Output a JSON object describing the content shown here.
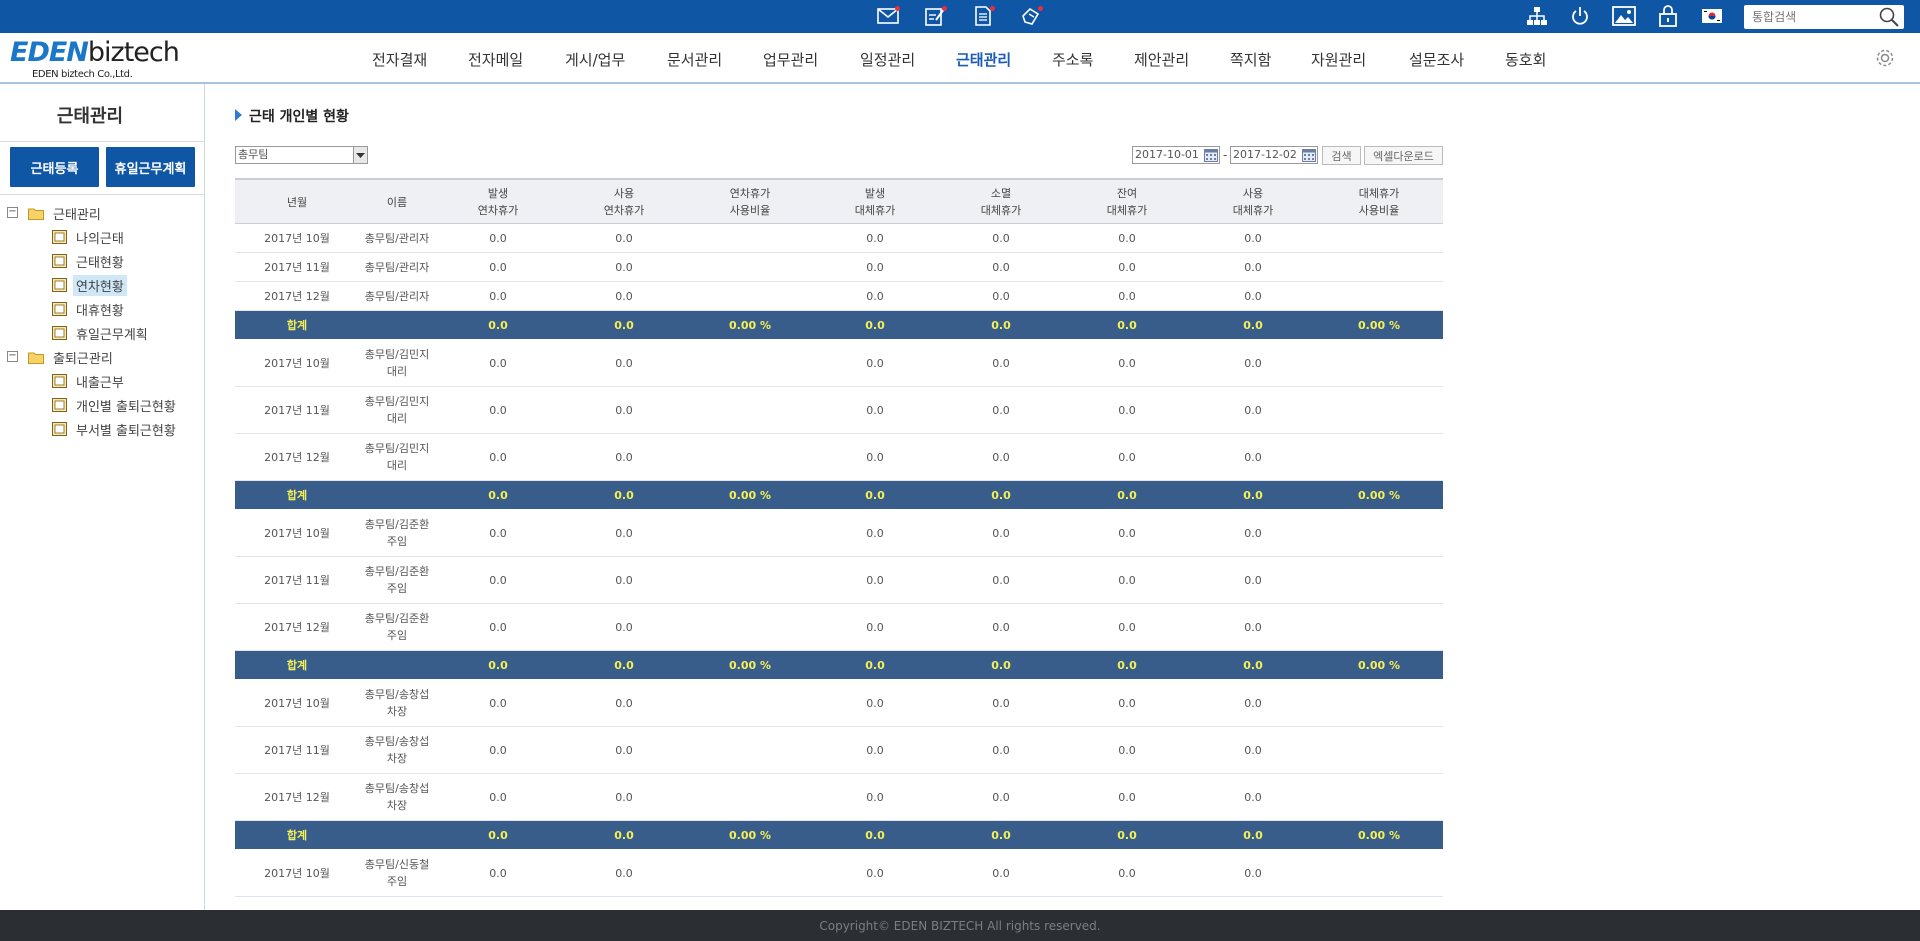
{
  "topbar": {
    "icons": [
      "mail-icon",
      "approval-icon",
      "document-icon",
      "hand-icon"
    ],
    "right_icons": [
      "org-chart-icon",
      "power-icon",
      "picture-icon",
      "lock-icon",
      "korea-flag-icon"
    ],
    "search_placeholder": "통합검색",
    "color": "#0f57a5"
  },
  "logo": {
    "main_eden": "EDEN",
    "main_biz": "biztech",
    "sub": "EDEN biztech Co.,Ltd."
  },
  "nav": {
    "items": [
      "전자결재",
      "전자메일",
      "게시/업무",
      "문서관리",
      "업무관리",
      "일정관리",
      "근태관리",
      "주소록",
      "제안관리",
      "쪽지함",
      "자원관리",
      "설문조사",
      "동호회"
    ],
    "active": "근태관리"
  },
  "sidebar": {
    "title": "근태관리",
    "btn_register": "근태등록",
    "btn_holiday": "휴일근무계획",
    "tree": [
      {
        "label": "근태관리",
        "type": "folder",
        "toggle": "−"
      },
      {
        "label": "나의근태",
        "type": "page"
      },
      {
        "label": "근태현황",
        "type": "page"
      },
      {
        "label": "연차현황",
        "type": "page",
        "selected": true
      },
      {
        "label": "대휴현황",
        "type": "page"
      },
      {
        "label": "휴일근무계획",
        "type": "page"
      },
      {
        "label": "출퇴근관리",
        "type": "folder",
        "toggle": "−"
      },
      {
        "label": "내출근부",
        "type": "page"
      },
      {
        "label": "개인별 출퇴근현황",
        "type": "page"
      },
      {
        "label": "부서별 출퇴근현황",
        "type": "page"
      }
    ]
  },
  "content": {
    "title": "근태 개인별 현황",
    "dept_value": "총무팀",
    "date_from": "2017-10-01",
    "date_sep": "-",
    "date_to": "2017-12-02",
    "search_btn": "검색",
    "excel_btn": "엑셀다운로드"
  },
  "table": {
    "headers": [
      [
        "년월"
      ],
      [
        "이름"
      ],
      [
        "발생",
        "연차휴가"
      ],
      [
        "사용",
        "연차휴가"
      ],
      [
        "연차휴가",
        "사용비율"
      ],
      [
        "발생",
        "대체휴가"
      ],
      [
        "소멸",
        "대체휴가"
      ],
      [
        "잔여",
        "대체휴가"
      ],
      [
        "사용",
        "대체휴가"
      ],
      [
        "대체휴가",
        "사용비율"
      ]
    ],
    "rows": [
      {
        "type": "data",
        "cells": [
          "2017년 10월",
          "총무팀/관리자",
          "0.0",
          "0.0",
          "",
          "0.0",
          "0.0",
          "0.0",
          "0.0",
          ""
        ]
      },
      {
        "type": "data",
        "cells": [
          "2017년 11월",
          "총무팀/관리자",
          "0.0",
          "0.0",
          "",
          "0.0",
          "0.0",
          "0.0",
          "0.0",
          ""
        ]
      },
      {
        "type": "data",
        "cells": [
          "2017년 12월",
          "총무팀/관리자",
          "0.0",
          "0.0",
          "",
          "0.0",
          "0.0",
          "0.0",
          "0.0",
          ""
        ]
      },
      {
        "type": "total",
        "cells": [
          "합계",
          "",
          "0.0",
          "0.0",
          "0.00 %",
          "0.0",
          "0.0",
          "0.0",
          "0.0",
          "0.00 %"
        ]
      },
      {
        "type": "data2",
        "cells": [
          "2017년 10월",
          "총무팀/김민지\n대리",
          "0.0",
          "0.0",
          "",
          "0.0",
          "0.0",
          "0.0",
          "0.0",
          ""
        ]
      },
      {
        "type": "data2",
        "cells": [
          "2017년 11월",
          "총무팀/김민지\n대리",
          "0.0",
          "0.0",
          "",
          "0.0",
          "0.0",
          "0.0",
          "0.0",
          ""
        ]
      },
      {
        "type": "data2",
        "cells": [
          "2017년 12월",
          "총무팀/김민지\n대리",
          "0.0",
          "0.0",
          "",
          "0.0",
          "0.0",
          "0.0",
          "0.0",
          ""
        ]
      },
      {
        "type": "total",
        "cells": [
          "합계",
          "",
          "0.0",
          "0.0",
          "0.00 %",
          "0.0",
          "0.0",
          "0.0",
          "0.0",
          "0.00 %"
        ]
      },
      {
        "type": "data2",
        "cells": [
          "2017년 10월",
          "총무팀/김준환\n주임",
          "0.0",
          "0.0",
          "",
          "0.0",
          "0.0",
          "0.0",
          "0.0",
          ""
        ]
      },
      {
        "type": "data2",
        "cells": [
          "2017년 11월",
          "총무팀/김준환\n주임",
          "0.0",
          "0.0",
          "",
          "0.0",
          "0.0",
          "0.0",
          "0.0",
          ""
        ]
      },
      {
        "type": "data2",
        "cells": [
          "2017년 12월",
          "총무팀/김준환\n주임",
          "0.0",
          "0.0",
          "",
          "0.0",
          "0.0",
          "0.0",
          "0.0",
          ""
        ]
      },
      {
        "type": "total",
        "cells": [
          "합계",
          "",
          "0.0",
          "0.0",
          "0.00 %",
          "0.0",
          "0.0",
          "0.0",
          "0.0",
          "0.00 %"
        ]
      },
      {
        "type": "data2",
        "cells": [
          "2017년 10월",
          "총무팀/송창섭\n차장",
          "0.0",
          "0.0",
          "",
          "0.0",
          "0.0",
          "0.0",
          "0.0",
          ""
        ]
      },
      {
        "type": "data2",
        "cells": [
          "2017년 11월",
          "총무팀/송창섭\n차장",
          "0.0",
          "0.0",
          "",
          "0.0",
          "0.0",
          "0.0",
          "0.0",
          ""
        ]
      },
      {
        "type": "data2",
        "cells": [
          "2017년 12월",
          "총무팀/송창섭\n차장",
          "0.0",
          "0.0",
          "",
          "0.0",
          "0.0",
          "0.0",
          "0.0",
          ""
        ]
      },
      {
        "type": "total",
        "cells": [
          "합계",
          "",
          "0.0",
          "0.0",
          "0.00 %",
          "0.0",
          "0.0",
          "0.0",
          "0.0",
          "0.00 %"
        ]
      },
      {
        "type": "data2",
        "cells": [
          "2017년 10월",
          "총무팀/신동철\n주임",
          "0.0",
          "0.0",
          "",
          "0.0",
          "0.0",
          "0.0",
          "0.0",
          ""
        ]
      }
    ]
  },
  "footer": {
    "copyright": "Copyright© EDEN BIZTECH All rights reserved."
  }
}
